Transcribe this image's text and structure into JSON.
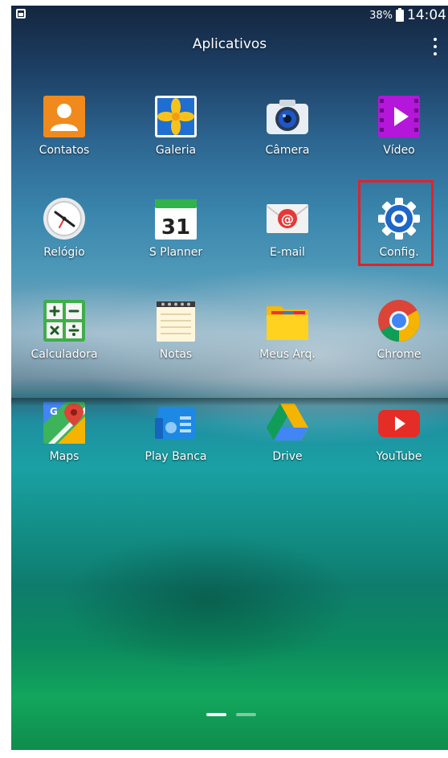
{
  "status_bar": {
    "battery": "38%",
    "time": "14:04"
  },
  "header": {
    "title": "Aplicativos"
  },
  "apps": [
    {
      "label": "Contatos",
      "icon": "contacts-icon"
    },
    {
      "label": "Galeria",
      "icon": "gallery-icon"
    },
    {
      "label": "Câmera",
      "icon": "camera-icon"
    },
    {
      "label": "Vídeo",
      "icon": "video-icon"
    },
    {
      "label": "Relógio",
      "icon": "clock-icon"
    },
    {
      "label": "S Planner",
      "icon": "calendar-icon",
      "badge": "31"
    },
    {
      "label": "E-mail",
      "icon": "email-icon"
    },
    {
      "label": "Config.",
      "icon": "settings-gear-icon"
    },
    {
      "label": "Calculadora",
      "icon": "calculator-icon"
    },
    {
      "label": "Notas",
      "icon": "notes-icon"
    },
    {
      "label": "Meus Arq.",
      "icon": "folder-icon"
    },
    {
      "label": "Chrome",
      "icon": "chrome-icon"
    },
    {
      "label": "Maps",
      "icon": "maps-icon"
    },
    {
      "label": "Play Banca",
      "icon": "newsstand-icon"
    },
    {
      "label": "Drive",
      "icon": "drive-icon"
    },
    {
      "label": "YouTube",
      "icon": "youtube-icon"
    }
  ],
  "pager": {
    "pages": 2,
    "current": 1
  },
  "highlight_color": "#e0232a"
}
